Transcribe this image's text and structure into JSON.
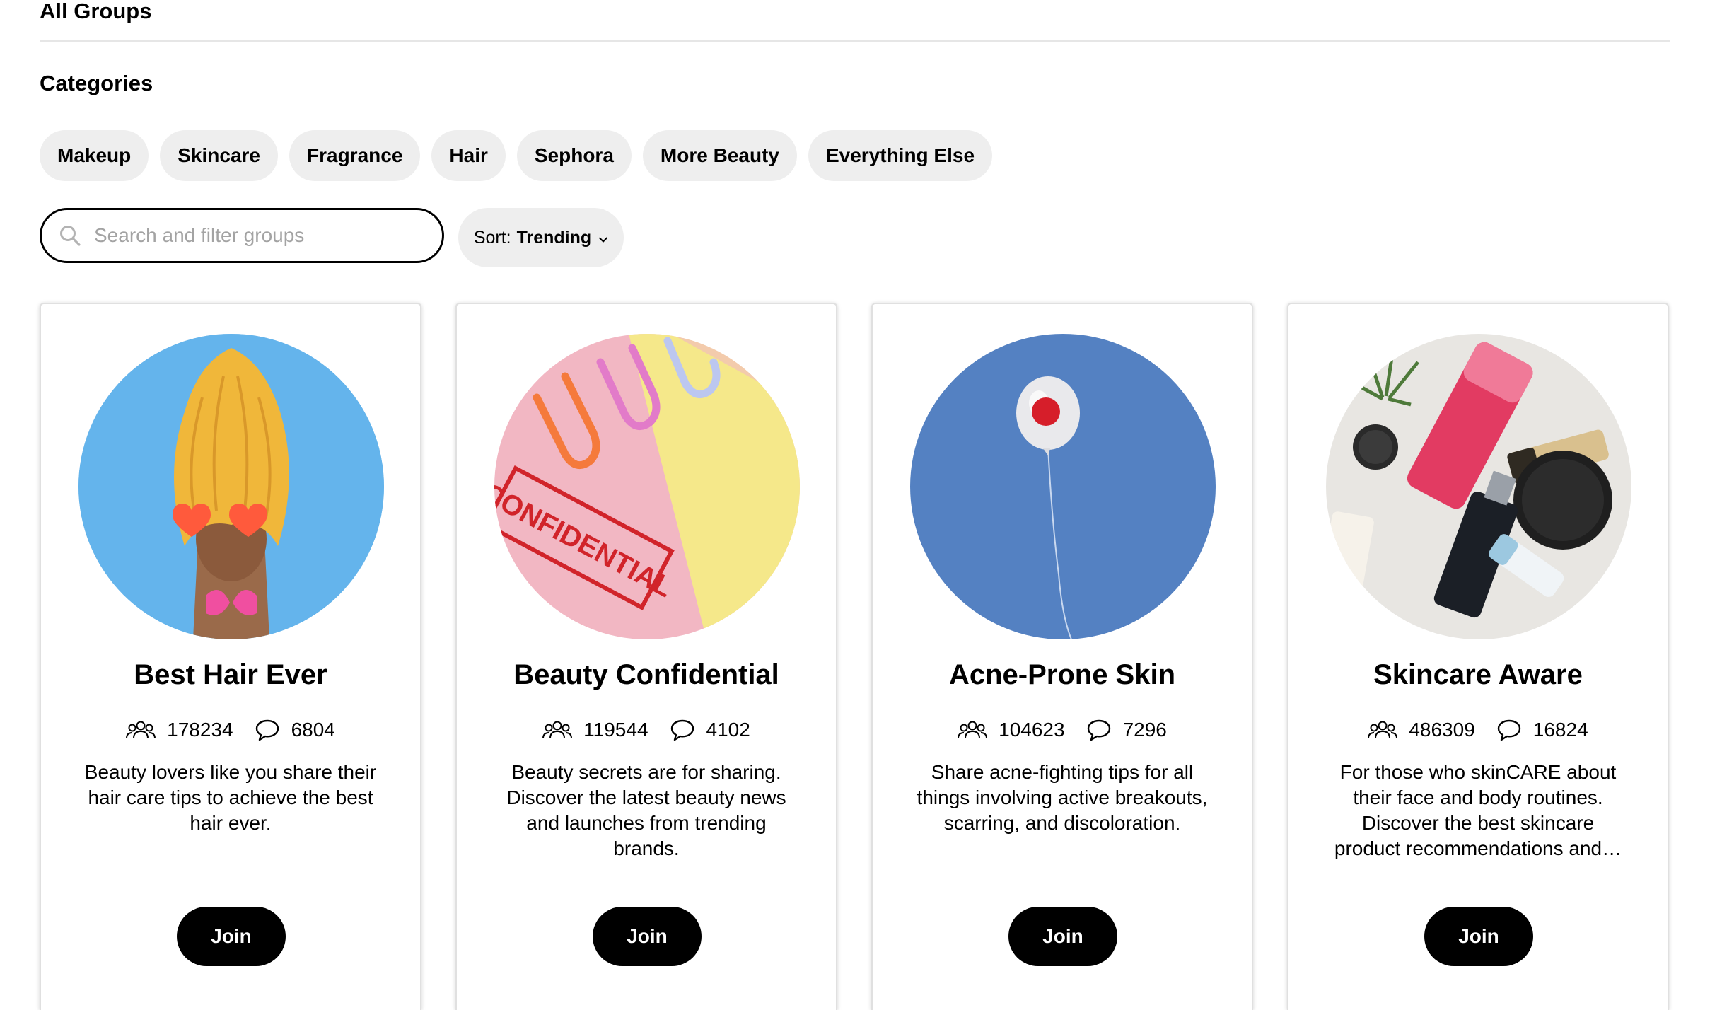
{
  "page": {
    "heading": "All Groups",
    "categories_title": "Categories"
  },
  "categories": [
    "Makeup",
    "Skincare",
    "Fragrance",
    "Hair",
    "Sephora",
    "More Beauty",
    "Everything Else"
  ],
  "search": {
    "placeholder": "Search and filter groups",
    "icon": "search-icon"
  },
  "sort": {
    "label": "Sort:",
    "value": "Trending",
    "icon": "chevron-down-icon"
  },
  "groups": [
    {
      "title": "Best Hair Ever",
      "members": "178234",
      "posts": "6804",
      "description": "Beauty lovers like you share their hair care tips to achieve the best hair ever.",
      "join_label": "Join",
      "image": "hair-illustration"
    },
    {
      "title": "Beauty Confidential",
      "members": "119544",
      "posts": "4102",
      "description": "Beauty secrets are for sharing. Discover the latest beauty news and launches from trending brands.",
      "join_label": "Join",
      "image": "confidential-stamp-with-paperclips",
      "image_text": "CONFIDENTIAL"
    },
    {
      "title": "Acne-Prone Skin",
      "members": "104623",
      "posts": "7296",
      "description": "Share acne-fighting tips for all things involving active breakouts, scarring, and discoloration.",
      "join_label": "Join",
      "image": "balloon-in-blue-sky"
    },
    {
      "title": "Skincare Aware",
      "members": "486309",
      "posts": "16824",
      "description": "For those who skinCARE about their face and body routines. Discover the best skincare product recommendations and…",
      "join_label": "Join",
      "image": "skincare-products-flatlay"
    }
  ],
  "colors": {
    "chip_bg": "#eeeeee",
    "button_bg": "#000000",
    "button_text": "#ffffff",
    "border": "#e0e0e0"
  }
}
